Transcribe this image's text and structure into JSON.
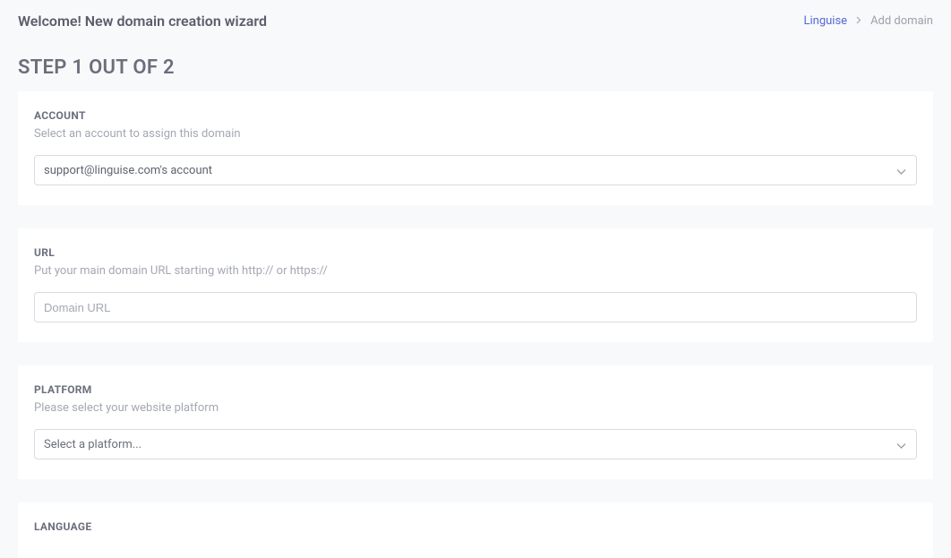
{
  "header": {
    "title": "Welcome! New domain creation wizard",
    "breadcrumb": {
      "link": "Linguise",
      "current": "Add domain"
    }
  },
  "step_title": "STEP 1 OUT OF 2",
  "account": {
    "label": "ACCOUNT",
    "help": "Select an account to assign this domain",
    "selected": "support@linguise.com's account"
  },
  "url": {
    "label": "URL",
    "help": "Put your main domain URL starting with http:// or https://",
    "placeholder": "Domain URL",
    "value": ""
  },
  "platform": {
    "label": "PLATFORM",
    "help": "Please select your website platform",
    "selected": "Select a platform..."
  },
  "language": {
    "label": "LANGUAGE"
  }
}
